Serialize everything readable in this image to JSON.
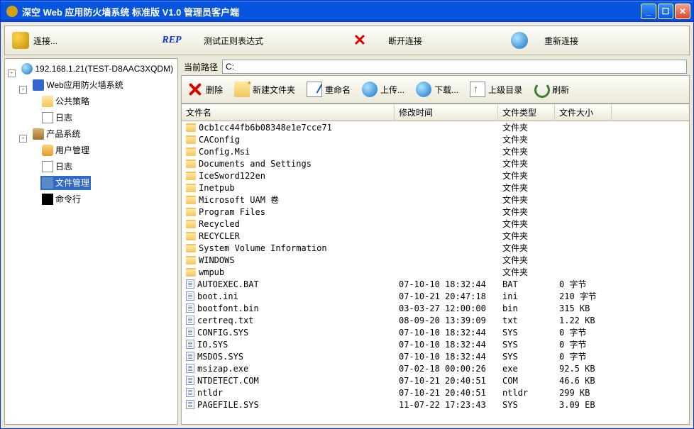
{
  "window": {
    "title": "深空 Web 应用防火墙系统 标准版 V1.0 管理员客户端"
  },
  "topToolbar": {
    "connect": "连接...",
    "rep": "REP",
    "testRegex": "测试正则表达式",
    "disconnect": "断开连接",
    "reconnect": "重新连接"
  },
  "tree": {
    "root": "192.168.1.21(TEST-D8AAC3XQDM)",
    "waf": "Web应用防火墙系统",
    "publicPolicy": "公共策略",
    "log1": "日志",
    "productSys": "产品系统",
    "userMgmt": "用户管理",
    "log2": "日志",
    "fileMgmt": "文件管理",
    "cmd": "命令行"
  },
  "path": {
    "label": "当前路径",
    "value": "C:"
  },
  "fileToolbar": {
    "delete": "删除",
    "newFolder": "新建文件夹",
    "rename": "重命名",
    "upload": "上传...",
    "download": "下载...",
    "upDir": "上级目录",
    "refresh": "刷新"
  },
  "listHeaders": {
    "name": "文件名",
    "date": "修改时间",
    "type": "文件类型",
    "size": "文件大小"
  },
  "folderTypeLabel": "文件夹",
  "rows": [
    {
      "name": "0cb1cc44fb6b08348e1e7cce71",
      "date": "",
      "type": "",
      "size": "",
      "kind": "folder"
    },
    {
      "name": "CAConfig",
      "date": "",
      "type": "",
      "size": "",
      "kind": "folder"
    },
    {
      "name": "Config.Msi",
      "date": "",
      "type": "",
      "size": "",
      "kind": "folder"
    },
    {
      "name": "Documents and Settings",
      "date": "",
      "type": "",
      "size": "",
      "kind": "folder"
    },
    {
      "name": "IceSword122en",
      "date": "",
      "type": "",
      "size": "",
      "kind": "folder"
    },
    {
      "name": "Inetpub",
      "date": "",
      "type": "",
      "size": "",
      "kind": "folder"
    },
    {
      "name": "Microsoft UAM 卷",
      "date": "",
      "type": "",
      "size": "",
      "kind": "folder"
    },
    {
      "name": "Program Files",
      "date": "",
      "type": "",
      "size": "",
      "kind": "folder"
    },
    {
      "name": "Recycled",
      "date": "",
      "type": "",
      "size": "",
      "kind": "folder"
    },
    {
      "name": "RECYCLER",
      "date": "",
      "type": "",
      "size": "",
      "kind": "folder"
    },
    {
      "name": "System Volume Information",
      "date": "",
      "type": "",
      "size": "",
      "kind": "folder"
    },
    {
      "name": "WINDOWS",
      "date": "",
      "type": "",
      "size": "",
      "kind": "folder"
    },
    {
      "name": "wmpub",
      "date": "",
      "type": "",
      "size": "",
      "kind": "folder"
    },
    {
      "name": "AUTOEXEC.BAT",
      "date": "07-10-10 18:32:44",
      "type": "BAT",
      "size": "0 字节",
      "kind": "file"
    },
    {
      "name": "boot.ini",
      "date": "07-10-21 20:47:18",
      "type": "ini",
      "size": "210 字节",
      "kind": "file"
    },
    {
      "name": "bootfont.bin",
      "date": "03-03-27 12:00:00",
      "type": "bin",
      "size": "315 KB",
      "kind": "file"
    },
    {
      "name": "certreq.txt",
      "date": "08-09-20 13:39:09",
      "type": "txt",
      "size": "1.22 KB",
      "kind": "file"
    },
    {
      "name": "CONFIG.SYS",
      "date": "07-10-10 18:32:44",
      "type": "SYS",
      "size": "0 字节",
      "kind": "file"
    },
    {
      "name": "IO.SYS",
      "date": "07-10-10 18:32:44",
      "type": "SYS",
      "size": "0 字节",
      "kind": "file"
    },
    {
      "name": "MSDOS.SYS",
      "date": "07-10-10 18:32:44",
      "type": "SYS",
      "size": "0 字节",
      "kind": "file"
    },
    {
      "name": "msizap.exe",
      "date": "07-02-18 00:00:26",
      "type": "exe",
      "size": "92.5 KB",
      "kind": "file"
    },
    {
      "name": "NTDETECT.COM",
      "date": "07-10-21 20:40:51",
      "type": "COM",
      "size": "46.6 KB",
      "kind": "file"
    },
    {
      "name": "ntldr",
      "date": "07-10-21 20:40:51",
      "type": "ntldr",
      "size": "299 KB",
      "kind": "file"
    },
    {
      "name": "PAGEFILE.SYS",
      "date": "11-07-22 17:23:43",
      "type": "SYS",
      "size": "3.09 EB",
      "kind": "file"
    }
  ]
}
